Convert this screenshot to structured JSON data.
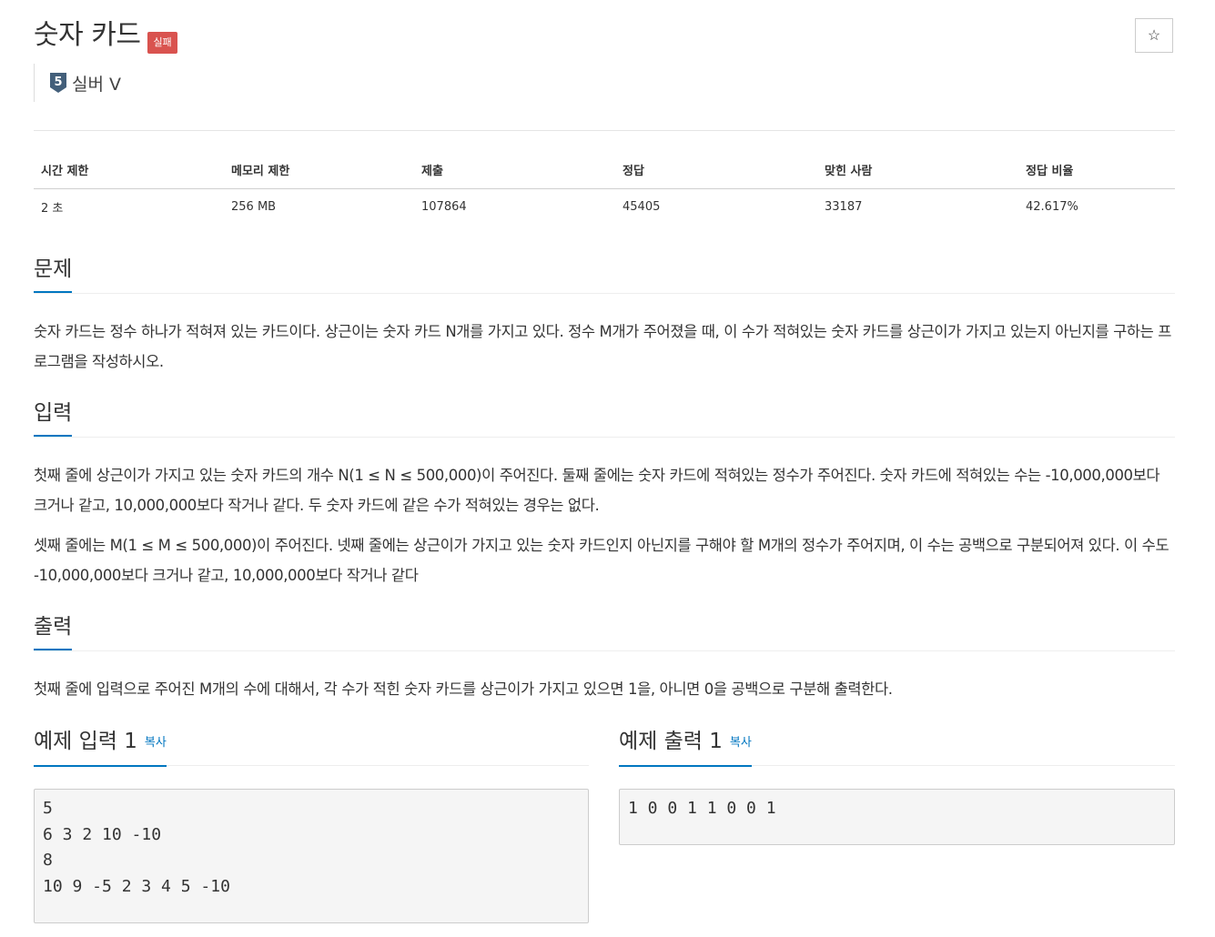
{
  "problem": {
    "title": "숫자 카드",
    "status_badge": "실패",
    "star_icon": "☆",
    "tier": {
      "number": "5",
      "label": "실버 V",
      "color": "#435f7a"
    }
  },
  "stats": {
    "headers": [
      "시간 제한",
      "메모리 제한",
      "제출",
      "정답",
      "맞힌 사람",
      "정답 비율"
    ],
    "values": [
      "2 초",
      "256 MB",
      "107864",
      "45405",
      "33187",
      "42.617%"
    ]
  },
  "sections": {
    "description": {
      "heading": "문제",
      "paragraphs": [
        "숫자 카드는 정수 하나가 적혀져 있는 카드이다. 상근이는 숫자 카드 N개를 가지고 있다. 정수 M개가 주어졌을 때, 이 수가 적혀있는 숫자 카드를 상근이가 가지고 있는지 아닌지를 구하는 프로그램을 작성하시오."
      ]
    },
    "input": {
      "heading": "입력",
      "paragraphs": [
        "첫째 줄에 상근이가 가지고 있는 숫자 카드의 개수 N(1 ≤ N ≤ 500,000)이 주어진다. 둘째 줄에는 숫자 카드에 적혀있는 정수가 주어진다. 숫자 카드에 적혀있는 수는 -10,000,000보다 크거나 같고, 10,000,000보다 작거나 같다. 두 숫자 카드에 같은 수가 적혀있는 경우는 없다.",
        "셋째 줄에는 M(1 ≤ M ≤ 500,000)이 주어진다. 넷째 줄에는 상근이가 가지고 있는 숫자 카드인지 아닌지를 구해야 할 M개의 정수가 주어지며, 이 수는 공백으로 구분되어져 있다. 이 수도 -10,000,000보다 크거나 같고, 10,000,000보다 작거나 같다"
      ]
    },
    "output": {
      "heading": "출력",
      "paragraphs": [
        "첫째 줄에 입력으로 주어진 M개의 수에 대해서, 각 수가 적힌 숫자 카드를 상근이가 가지고 있으면 1을, 아니면 0을 공백으로 구분해 출력한다."
      ]
    }
  },
  "samples": {
    "input": {
      "heading": "예제 입력 1",
      "copy_label": "복사",
      "content": "5\n6 3 2 10 -10\n8\n10 9 -5 2 3 4 5 -10"
    },
    "output": {
      "heading": "예제 출력 1",
      "copy_label": "복사",
      "content": "1 0 0 1 1 0 0 1"
    }
  },
  "colors": {
    "accent": "#0076c0",
    "fail_badge": "#d9534f"
  }
}
